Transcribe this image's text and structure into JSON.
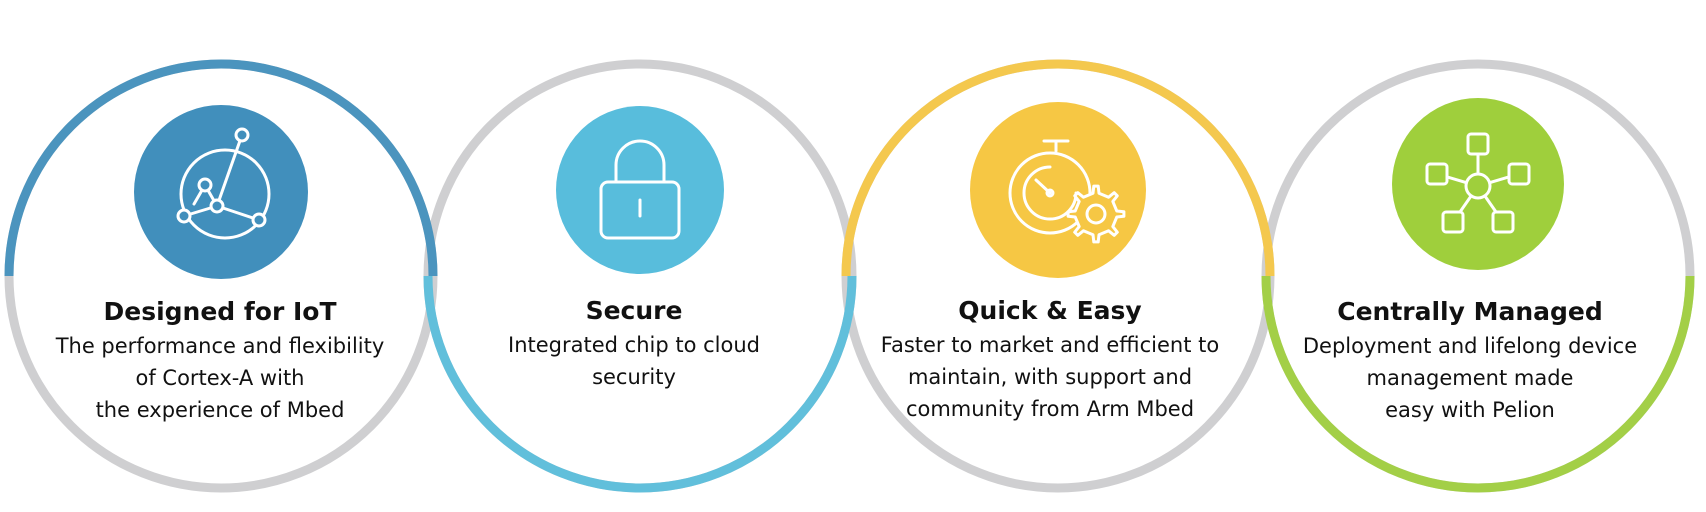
{
  "features": [
    {
      "icon": "network-nodes-icon",
      "accent": "#418fbc",
      "title": "Designed for IoT",
      "lines": [
        "The performance and flexibility",
        "of Cortex-A with",
        "the experience of Mbed"
      ]
    },
    {
      "icon": "padlock-icon",
      "accent": "#58bddc",
      "title": "Secure",
      "lines": [
        "Integrated chip to cloud",
        "security"
      ]
    },
    {
      "icon": "stopwatch-gear-icon",
      "accent": "#f6c744",
      "title": "Quick & Easy",
      "lines": [
        "Faster to market and efficient to",
        "maintain, with support and",
        "community from Arm Mbed"
      ]
    },
    {
      "icon": "hub-network-icon",
      "accent": "#9fcf3c",
      "title": "Centrally Managed",
      "lines": [
        "Deployment and lifelong device",
        "management made",
        "easy with Pelion"
      ]
    }
  ],
  "ring_color": "#cfcfd1"
}
